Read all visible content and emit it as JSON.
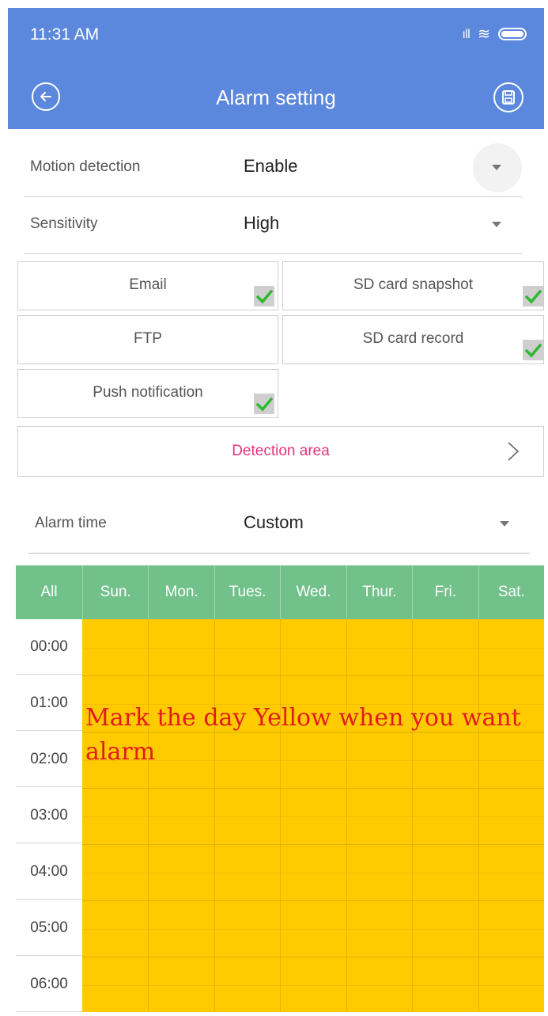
{
  "status": {
    "time": "11:31 AM"
  },
  "header": {
    "title": "Alarm setting"
  },
  "motion": {
    "label": "Motion detection",
    "value": "Enable"
  },
  "sensitivity": {
    "label": "Sensitivity",
    "value": "High"
  },
  "options": {
    "email": {
      "label": "Email",
      "checked": true
    },
    "sd_snapshot": {
      "label": "SD card snapshot",
      "checked": true
    },
    "ftp": {
      "label": "FTP",
      "checked": false
    },
    "sd_record": {
      "label": "SD card record",
      "checked": true
    },
    "push": {
      "label": "Push notification",
      "checked": true
    }
  },
  "detection_area": {
    "label": "Detection area"
  },
  "alarm_time": {
    "label": "Alarm time",
    "value": "Custom"
  },
  "schedule": {
    "days": [
      "All",
      "Sun.",
      "Mon.",
      "Tues.",
      "Wed.",
      "Thur.",
      "Fri.",
      "Sat."
    ],
    "times": [
      "00:00",
      "01:00",
      "02:00",
      "03:00",
      "04:00",
      "05:00",
      "06:00"
    ],
    "selected_color": "#ffca00"
  },
  "annotation": "Mark the day Yellow when you want alarm",
  "colors": {
    "accent": "#5b87dd",
    "header_green": "#72c08a",
    "link_pink": "#e8337b",
    "check_green": "#2fb82f"
  }
}
